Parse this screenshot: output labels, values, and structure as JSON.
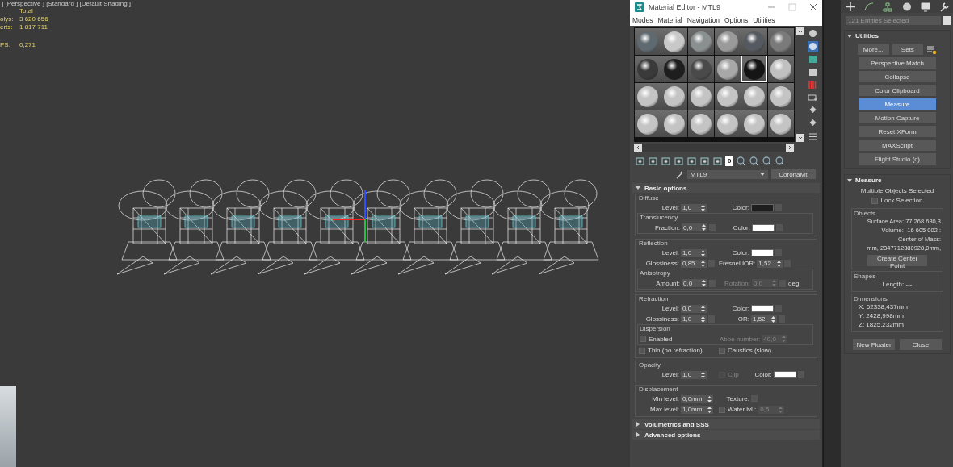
{
  "viewport": {
    "label": "] [Perspective ] [Standard ] [Default Shading ]",
    "stats_header": "Total",
    "stats": [
      {
        "label": "olys:",
        "value": "3 620 656"
      },
      {
        "label": "erts:",
        "value": "1 817 711"
      }
    ],
    "fps": {
      "label": "PS:",
      "value": "0,271"
    }
  },
  "material_editor": {
    "title": "Material Editor - MTL9",
    "menu": [
      "Modes",
      "Material",
      "Navigation",
      "Options",
      "Utilities"
    ],
    "slots": [
      {
        "color": "#5f6a70",
        "selected": false
      },
      {
        "color": "#c8c8c8",
        "selected": false
      },
      {
        "color": "#8a8f8f",
        "selected": false
      },
      {
        "color": "#9a9a9a",
        "selected": false
      },
      {
        "color": "#555a60",
        "selected": false
      },
      {
        "color": "#7a7a7a",
        "selected": false
      },
      {
        "color": "#3a3a3a",
        "selected": false
      },
      {
        "color": "#1e1e1e",
        "selected": false
      },
      {
        "color": "#4a4a4a",
        "selected": false
      },
      {
        "color": "#a8a8a8",
        "selected": false
      },
      {
        "color": "#151515",
        "selected": true
      },
      {
        "color": "#c0c0c0",
        "selected": false
      },
      {
        "color": "#c4c4c4",
        "selected": false
      },
      {
        "color": "#c4c4c4",
        "selected": false
      },
      {
        "color": "#c4c4c4",
        "selected": false
      },
      {
        "color": "#c4c4c4",
        "selected": false
      },
      {
        "color": "#c4c4c4",
        "selected": false
      },
      {
        "color": "#c4c4c4",
        "selected": false
      },
      {
        "color": "#c4c4c4",
        "selected": false
      },
      {
        "color": "#c4c4c4",
        "selected": false
      },
      {
        "color": "#c4c4c4",
        "selected": false
      },
      {
        "color": "#c4c4c4",
        "selected": false
      },
      {
        "color": "#c4c4c4",
        "selected": false
      },
      {
        "color": "#c4c4c4",
        "selected": false
      }
    ],
    "effects_channel": "0",
    "material_name": "MTL9",
    "material_type": "CoronaMtl",
    "rollouts": [
      {
        "title": "Basic options",
        "expanded": true,
        "groups": [
          {
            "title": "Diffuse",
            "rows": [
              {
                "kind": "row",
                "fields": [
                  {
                    "kind": "spinner",
                    "label": "Level:",
                    "value": "1,0",
                    "disabled": false
                  },
                  {
                    "kind": "swatch",
                    "label": "Color:",
                    "color": "#1e1e1e"
                  }
                ]
              },
              {
                "kind": "group",
                "title": "Translucency",
                "rows": [
                  {
                    "kind": "row",
                    "fields": [
                      {
                        "kind": "spinner",
                        "label": "Fraction:",
                        "value": "0,0",
                        "disabled": false,
                        "map": true
                      },
                      {
                        "kind": "swatch",
                        "label": "Color:",
                        "color": "#ffffff"
                      }
                    ]
                  }
                ]
              }
            ]
          },
          {
            "title": "Reflection",
            "rows": [
              {
                "kind": "row",
                "fields": [
                  {
                    "kind": "spinner",
                    "label": "Level:",
                    "value": "1,0",
                    "disabled": false
                  },
                  {
                    "kind": "swatch",
                    "label": "Color:",
                    "color": "#ffffff"
                  }
                ]
              },
              {
                "kind": "row",
                "fields": [
                  {
                    "kind": "spinner",
                    "label": "Glossiness:",
                    "value": "0,85",
                    "disabled": false,
                    "map": true
                  },
                  {
                    "kind": "spinner",
                    "label": "Fresnel IOR:",
                    "value": "1,52",
                    "disabled": false,
                    "map": true
                  }
                ]
              },
              {
                "kind": "group",
                "title": "Anisotropy",
                "rows": [
                  {
                    "kind": "row",
                    "fields": [
                      {
                        "kind": "spinner",
                        "label": "Amount:",
                        "value": "0,0",
                        "disabled": false,
                        "map": true
                      },
                      {
                        "kind": "spinner",
                        "label": "Rotation:",
                        "value": "0,0",
                        "disabled": true,
                        "map": true
                      },
                      {
                        "kind": "unit",
                        "text": "deg"
                      }
                    ]
                  }
                ]
              }
            ]
          },
          {
            "title": "Refraction",
            "rows": [
              {
                "kind": "row",
                "fields": [
                  {
                    "kind": "spinner",
                    "label": "Level:",
                    "value": "0,0",
                    "disabled": false
                  },
                  {
                    "kind": "swatch",
                    "label": "Color:",
                    "color": "#ffffff"
                  }
                ]
              },
              {
                "kind": "row",
                "fields": [
                  {
                    "kind": "spinner",
                    "label": "Glossiness:",
                    "value": "1,0",
                    "disabled": false,
                    "map": true
                  },
                  {
                    "kind": "spinner",
                    "label": "IOR:",
                    "value": "1,52",
                    "disabled": false,
                    "map": true
                  }
                ]
              },
              {
                "kind": "group",
                "title": "Dispersion",
                "rows": [
                  {
                    "kind": "row",
                    "fields": [
                      {
                        "kind": "check",
                        "label": "Enabled",
                        "checked": false,
                        "disabled": false
                      },
                      {
                        "kind": "spinner",
                        "label": "Abbe number:",
                        "value": "40,0",
                        "disabled": true
                      }
                    ]
                  }
                ]
              },
              {
                "kind": "row",
                "fields": [
                  {
                    "kind": "check",
                    "label": "Thin (no refraction)",
                    "checked": false,
                    "disabled": false
                  },
                  {
                    "kind": "check",
                    "label": "Caustics (slow)",
                    "checked": false,
                    "disabled": false
                  }
                ]
              }
            ]
          },
          {
            "title": "Opacity",
            "rows": [
              {
                "kind": "row",
                "fields": [
                  {
                    "kind": "spinner",
                    "label": "Level:",
                    "value": "1,0",
                    "disabled": false
                  },
                  {
                    "kind": "check",
                    "label": "Clip",
                    "checked": false,
                    "disabled": true
                  },
                  {
                    "kind": "swatch",
                    "label": "Color:",
                    "color": "#ffffff"
                  }
                ]
              }
            ]
          },
          {
            "title": "Displacement",
            "rows": [
              {
                "kind": "row",
                "fields": [
                  {
                    "kind": "spinner",
                    "label": "Min level:",
                    "value": "0,0mm",
                    "disabled": false
                  },
                  {
                    "kind": "slot",
                    "label": "Texture:"
                  }
                ]
              },
              {
                "kind": "row",
                "fields": [
                  {
                    "kind": "spinner",
                    "label": "Max level:",
                    "value": "1,0mm",
                    "disabled": false
                  },
                  {
                    "kind": "check",
                    "label": "Water lvl.:",
                    "checked": false,
                    "disabled": false
                  },
                  {
                    "kind": "spinner",
                    "value": "0,5",
                    "disabled": true
                  }
                ]
              }
            ]
          }
        ]
      },
      {
        "title": "Volumetrics and SSS",
        "expanded": false
      },
      {
        "title": "Advanced options",
        "expanded": false
      }
    ]
  },
  "command_panel": {
    "selection": "121 Entities Selected",
    "utilities": {
      "title": "Utilities",
      "more": "More...",
      "sets": "Sets",
      "buttons": [
        {
          "label": "Perspective Match",
          "selected": false
        },
        {
          "label": "Collapse",
          "selected": false
        },
        {
          "label": "Color Clipboard",
          "selected": false
        },
        {
          "label": "Measure",
          "selected": true
        },
        {
          "label": "Motion Capture",
          "selected": false
        },
        {
          "label": "Reset XForm",
          "selected": false
        },
        {
          "label": "MAXScript",
          "selected": false
        },
        {
          "label": "Flight Studio (c)",
          "selected": false
        }
      ]
    },
    "measure": {
      "title": "Measure",
      "status": "Multiple Objects Selected",
      "lock": {
        "label": "Lock Selection",
        "checked": false
      },
      "objects": {
        "title": "Objects",
        "lines": [
          "Surface Area: 77 268 630,3",
          "Volume: -16 605 002 :",
          "Center of Mass:",
          "mm, 2347712380928,0mm,"
        ],
        "button": "Create Center Point"
      },
      "shapes": {
        "title": "Shapes",
        "lines": [
          "Length: ---"
        ]
      },
      "dimensions": {
        "title": "Dimensions",
        "lines": [
          "X:  62338,437mm",
          "Y:  2428,998mm",
          "Z:  1825,232mm"
        ]
      },
      "buttons": [
        "New Floater",
        "Close"
      ]
    }
  }
}
